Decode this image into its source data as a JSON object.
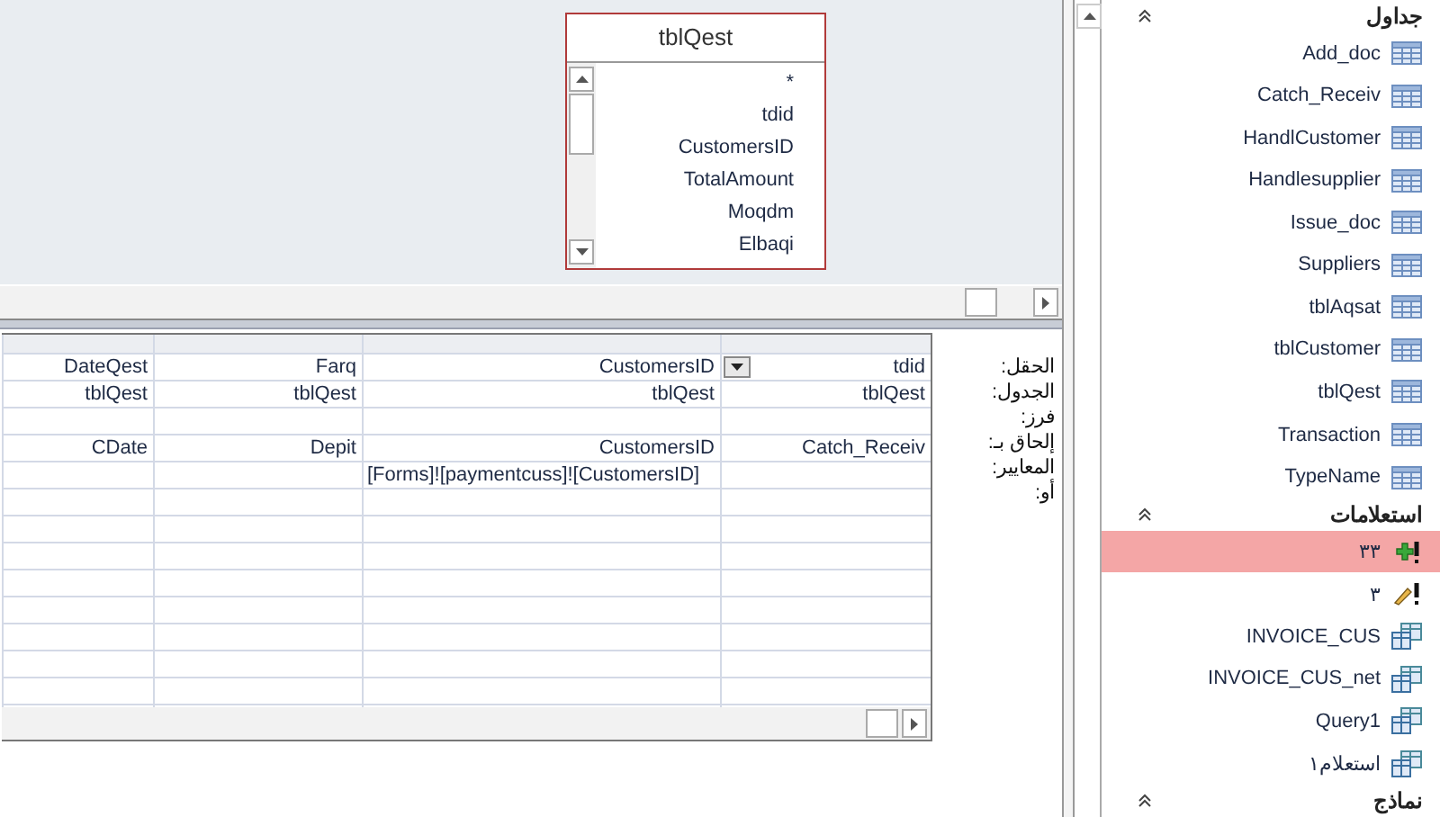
{
  "table_box": {
    "title": "tblQest",
    "fields": [
      "*",
      "tdid",
      "CustomersID",
      "TotalAmount",
      "Moqdm",
      "Elbaqi"
    ]
  },
  "grid": {
    "row_labels": [
      "الحقل:",
      "الجدول:",
      "فرز:",
      "إلحاق بـ:",
      "المعايير:",
      "أو:"
    ],
    "columns": [
      {
        "field": "DateQest",
        "table": "tblQest",
        "append_to": "CDate",
        "active": false
      },
      {
        "field": "Farq",
        "table": "tblQest",
        "append_to": "Depit",
        "active": false
      },
      {
        "field": "CustomersID",
        "table": "tblQest",
        "append_to": "CustomersID",
        "criteria": "[Forms]![paymentcuss]![CustomersID]",
        "active": false
      },
      {
        "field": "tdid",
        "table": "tblQest",
        "append_to": "Catch_Receiv",
        "active": true
      }
    ]
  },
  "nav": {
    "groups": [
      {
        "title": "جداول",
        "items": [
          {
            "label": "Add_doc",
            "kind": "table",
            "selected": false
          },
          {
            "label": "Catch_Receiv",
            "kind": "table",
            "selected": false
          },
          {
            "label": "HandlCustomer",
            "kind": "table",
            "selected": false
          },
          {
            "label": "Handlesupplier",
            "kind": "table",
            "selected": false
          },
          {
            "label": "Issue_doc",
            "kind": "table",
            "selected": false
          },
          {
            "label": "Suppliers",
            "kind": "table",
            "selected": false
          },
          {
            "label": "tblAqsat",
            "kind": "table",
            "selected": false
          },
          {
            "label": "tblCustomer",
            "kind": "table",
            "selected": false
          },
          {
            "label": "tblQest",
            "kind": "table",
            "selected": false
          },
          {
            "label": "Transaction",
            "kind": "table",
            "selected": false
          },
          {
            "label": "TypeName",
            "kind": "table",
            "selected": false
          }
        ]
      },
      {
        "title": "استعلامات",
        "items": [
          {
            "label": "٣٣",
            "kind": "append",
            "selected": true
          },
          {
            "label": "٣",
            "kind": "update",
            "selected": false
          },
          {
            "label": "INVOICE_CUS",
            "kind": "query",
            "selected": false
          },
          {
            "label": "INVOICE_CUS_net",
            "kind": "query",
            "selected": false
          },
          {
            "label": "Query1",
            "kind": "query",
            "selected": false
          },
          {
            "label": "استعلام١",
            "kind": "query",
            "selected": false
          }
        ]
      },
      {
        "title": "نماذج"
      }
    ]
  }
}
